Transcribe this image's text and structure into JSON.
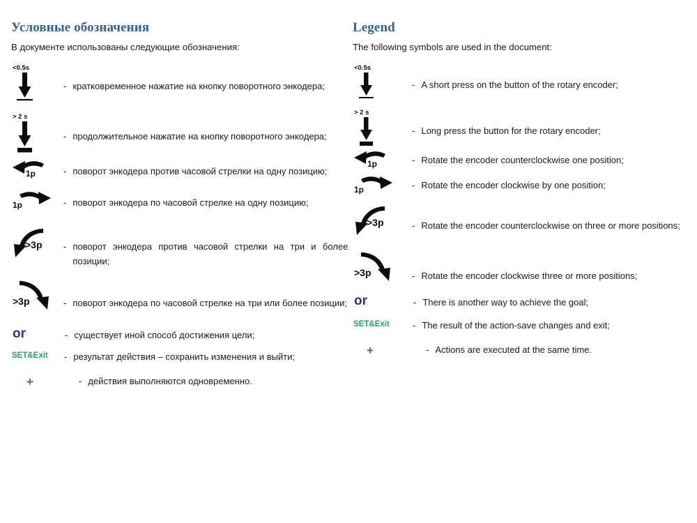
{
  "left": {
    "heading": "Условные обозначения",
    "intro": "В документе использованы следующие обозначения:",
    "dash": "-",
    "items": [
      {
        "symbol": "short-press-arrow-icon",
        "label": "<0.5s",
        "text": "кратковременное нажатие на кнопку поворотного энкодера;"
      },
      {
        "symbol": "long-press-arrow-icon",
        "label": "> 2 s",
        "text": "продолжительное нажатие на кнопку поворотного энкодера;"
      },
      {
        "symbol": "rotate-ccw-one-icon",
        "label": "1p",
        "text": "поворот энкодера против часовой стрелки на одну позицию;"
      },
      {
        "symbol": "rotate-cw-one-icon",
        "label": "1p",
        "text": "поворот энкодера по часовой стрелке на одну позицию;"
      },
      {
        "symbol": "rotate-ccw-three-icon",
        "label": ">3p",
        "text": "поворот энкодера против часовой стрелки на три и более позиции;"
      },
      {
        "symbol": "rotate-cw-three-icon",
        "label": ">3p",
        "text": "поворот энкодера по часовой стрелке на три или более позиции;"
      },
      {
        "symbol": "or-text-icon",
        "label": "or",
        "text": "существует иной способ достижения цели;"
      },
      {
        "symbol": "set-exit-text-icon",
        "label": "SET&Exit",
        "text": "результат действия – сохранить изменения и выйти;"
      },
      {
        "symbol": "plus-text-icon",
        "label": "+",
        "text": "действия выполняются одновременно."
      }
    ]
  },
  "right": {
    "heading": "Legend",
    "intro": "The following symbols are used in the document:",
    "dash": "-",
    "items": [
      {
        "symbol": "short-press-arrow-icon",
        "label": "<0.5s",
        "text": "A short press on the button of the rotary encoder;"
      },
      {
        "symbol": "long-press-arrow-icon",
        "label": "> 2 s",
        "text": "Long press the button for the rotary encoder;"
      },
      {
        "symbol": "rotate-ccw-one-icon",
        "label": "1p",
        "text": "Rotate the encoder counterclockwise one position;"
      },
      {
        "symbol": "rotate-cw-one-icon",
        "label": "1p",
        "text": "Rotate the encoder clockwise by one position;"
      },
      {
        "symbol": "rotate-ccw-three-icon",
        "label": ">3p",
        "text": "Rotate the encoder counterclockwise on three or more positions;"
      },
      {
        "symbol": "rotate-cw-three-icon",
        "label": ">3p",
        "text": "Rotate the encoder clockwise three or more positions;"
      },
      {
        "symbol": "or-text-icon",
        "label": "or",
        "text": "There is another way to achieve the goal;"
      },
      {
        "symbol": "set-exit-text-icon",
        "label": "SET&Exit",
        "text": "The result of the action-save changes and exit;"
      },
      {
        "symbol": "plus-text-icon",
        "label": "+",
        "text": "Actions are executed at the same time."
      }
    ]
  },
  "colors": {
    "heading": "#376092",
    "body_text": "#1a1a1a",
    "symbol_black": "#0d0d0d",
    "or_indigo": "#2f2f9e",
    "set_exit_green": "#21a366",
    "plus_blue": "#2f6fbe"
  }
}
